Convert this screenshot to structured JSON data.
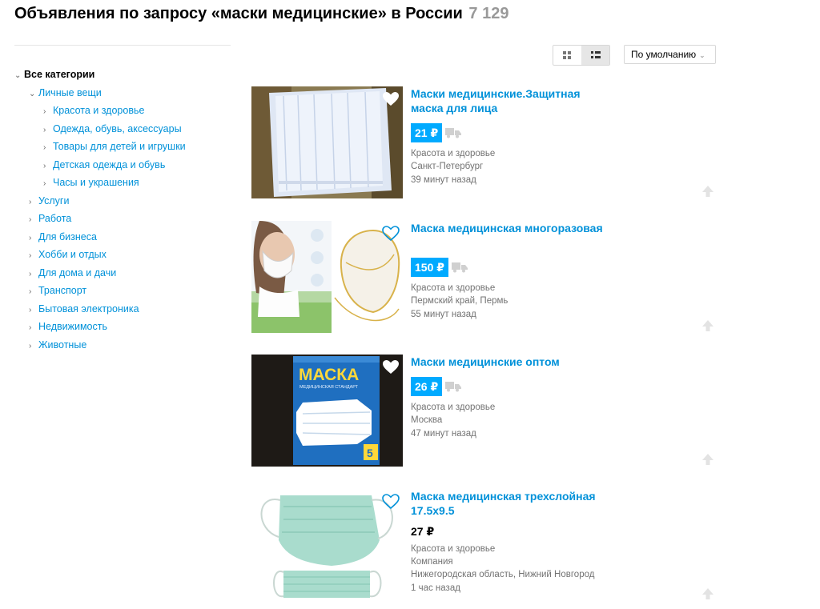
{
  "header": {
    "title": "Объявления по запросу «маски медицинские» в России",
    "count": "7 129"
  },
  "sidebar": {
    "items": [
      {
        "label": "Все категории"
      },
      {
        "label": "Личные вещи"
      },
      {
        "label": "Красота и здоровье"
      },
      {
        "label": "Одежда, обувь, аксессуары"
      },
      {
        "label": "Товары для детей и игрушки"
      },
      {
        "label": "Детская одежда и обувь"
      },
      {
        "label": "Часы и украшения"
      },
      {
        "label": "Услуги"
      },
      {
        "label": "Работа"
      },
      {
        "label": "Для бизнеса"
      },
      {
        "label": "Хобби и отдых"
      },
      {
        "label": "Для дома и дачи"
      },
      {
        "label": "Транспорт"
      },
      {
        "label": "Бытовая электроника"
      },
      {
        "label": "Недвижимость"
      },
      {
        "label": "Животные"
      }
    ]
  },
  "toolbar": {
    "sort_label": "По умолчанию",
    "view_grid_icon": "grid-view-icon",
    "view_list_icon": "list-view-icon"
  },
  "listings": [
    {
      "title": "Маски медицинские.Защитная маска для лица",
      "price": "21 ₽",
      "category": "Красота и здоровье",
      "location": "Санкт-Петербург",
      "time": "39 минут назад"
    },
    {
      "title": "Маска медицинская многоразовая",
      "price": "150 ₽",
      "category": "Красота и здоровье",
      "location": "Пермский край, Пермь",
      "time": "55 минут назад"
    },
    {
      "title": "Маски медицинские оптом",
      "price": "26 ₽",
      "category": "Красота и здоровье",
      "location": "Москва",
      "time": "47 минут назад"
    },
    {
      "title": "Маска медицинская трехслойная 17.5x9.5",
      "price": "27 ₽",
      "category": "Красота и здоровье",
      "company": "Компания",
      "location": "Нижегородская область, Нижний Новгород",
      "time": "1 час назад"
    }
  ],
  "packaging_text": {
    "brand": "МАСКА",
    "subtitle": "МЕДИЦИНСКАЯ СТАНДАРТ",
    "qty": "5"
  },
  "colors": {
    "link": "#0091d9",
    "price_badge": "#00aaff",
    "muted": "#737373"
  }
}
